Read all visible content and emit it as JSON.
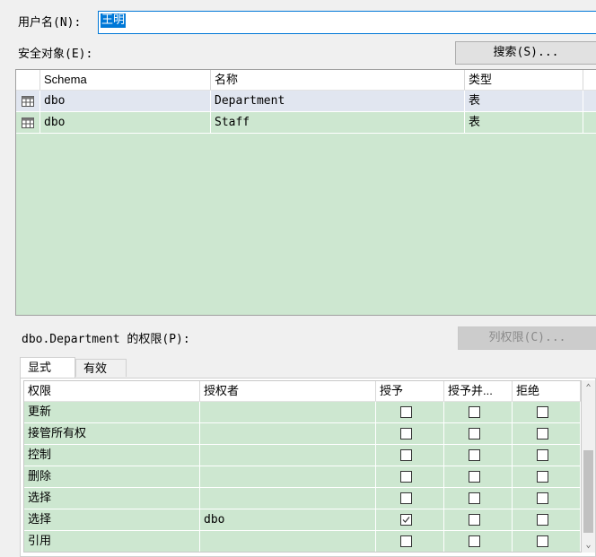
{
  "user": {
    "label": "用户名(N):",
    "value": "王明"
  },
  "securables": {
    "label": "安全对象(E):",
    "search_button": "搜索(S)...",
    "columns": [
      "Schema",
      "名称",
      "类型"
    ],
    "rows": [
      {
        "schema": "dbo",
        "name": "Department",
        "type": "表"
      },
      {
        "schema": "dbo",
        "name": "Staff",
        "type": "表"
      }
    ]
  },
  "permissions": {
    "label": "dbo.Department 的权限(P):",
    "column_button": "列权限(C)...",
    "tabs": [
      "显式",
      "有效"
    ],
    "columns": [
      "权限",
      "授权者",
      "授予",
      "授予并...",
      "拒绝"
    ],
    "rows": [
      {
        "permission": "更新",
        "grantor": "",
        "grant": false,
        "with_grant": false,
        "deny": false
      },
      {
        "permission": "接管所有权",
        "grantor": "",
        "grant": false,
        "with_grant": false,
        "deny": false
      },
      {
        "permission": "控制",
        "grantor": "",
        "grant": false,
        "with_grant": false,
        "deny": false
      },
      {
        "permission": "删除",
        "grantor": "",
        "grant": false,
        "with_grant": false,
        "deny": false
      },
      {
        "permission": "选择",
        "grantor": "",
        "grant": false,
        "with_grant": false,
        "deny": false
      },
      {
        "permission": "选择",
        "grantor": "dbo",
        "grant": true,
        "with_grant": false,
        "deny": false
      },
      {
        "permission": "引用",
        "grantor": "",
        "grant": false,
        "with_grant": false,
        "deny": false
      }
    ]
  },
  "colors": {
    "grid_green": "#cde7d0",
    "selected_row": "#e1e6f0",
    "accent": "#0078d7"
  }
}
